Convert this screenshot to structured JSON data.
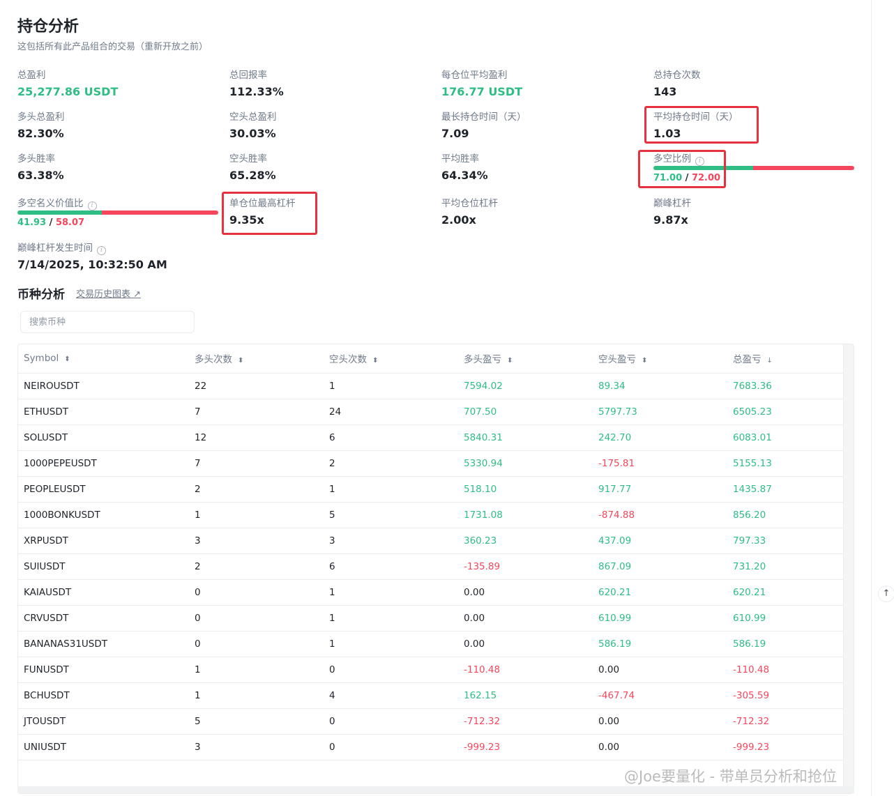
{
  "header": {
    "title": "持仓分析",
    "subtitle": "这包括所有此产品组合的交易（重新开放之前）"
  },
  "stats": {
    "total_pnl": {
      "label": "总盈利",
      "value": "25,277.86 USDT"
    },
    "total_return": {
      "label": "总回报率",
      "value": "112.33%"
    },
    "avg_pnl_per_position": {
      "label": "每仓位平均盈利",
      "value": "176.77 USDT"
    },
    "total_positions": {
      "label": "总持仓次数",
      "value": "143"
    },
    "long_total_pnl": {
      "label": "多头总盈利",
      "value": "82.30%"
    },
    "short_total_pnl": {
      "label": "空头总盈利",
      "value": "30.03%"
    },
    "longest_hold": {
      "label": "最长持仓时间（天）",
      "value": "7.09"
    },
    "avg_hold": {
      "label": "平均持仓时间（天）",
      "value": "1.03"
    },
    "long_win_rate": {
      "label": "多头胜率",
      "value": "63.38%"
    },
    "short_win_rate": {
      "label": "空头胜率",
      "value": "65.28%"
    },
    "avg_win_rate": {
      "label": "平均胜率",
      "value": "64.34%"
    },
    "long_short_ratio": {
      "label": "多空比例",
      "long": "71.00",
      "short": "72.00",
      "separator": "/",
      "long_fraction": 0.4965
    },
    "notional_ratio": {
      "label": "多空名义价值比",
      "long": "41.93",
      "short": "58.07",
      "separator": "/",
      "long_fraction": 0.4193
    },
    "max_leverage": {
      "label": "单仓位最高杠杆",
      "value": "9.35x"
    },
    "avg_leverage": {
      "label": "平均仓位杠杆",
      "value": "2.00x"
    },
    "peak_leverage": {
      "label": "巅峰杠杆",
      "value": "9.87x"
    },
    "peak_leverage_time": {
      "label": "巅峰杠杆发生时间",
      "value": "7/14/2025, 10:32:50 AM"
    }
  },
  "coin_section": {
    "title": "币种分析",
    "history_link": "交易历史图表 ↗",
    "search_placeholder": "搜索币种"
  },
  "table": {
    "headers": [
      "Symbol",
      "多头次数",
      "空头次数",
      "多头盈亏",
      "空头盈亏",
      "总盈亏"
    ],
    "rows": [
      [
        "NEIROUSDT",
        "22",
        "1",
        "7594.02",
        "89.34",
        "7683.36"
      ],
      [
        "ETHUSDT",
        "7",
        "24",
        "707.50",
        "5797.73",
        "6505.23"
      ],
      [
        "SOLUSDT",
        "12",
        "6",
        "5840.31",
        "242.70",
        "6083.01"
      ],
      [
        "1000PEPEUSDT",
        "7",
        "2",
        "5330.94",
        "-175.81",
        "5155.13"
      ],
      [
        "PEOPLEUSDT",
        "2",
        "1",
        "518.10",
        "917.77",
        "1435.87"
      ],
      [
        "1000BONKUSDT",
        "1",
        "5",
        "1731.08",
        "-874.88",
        "856.20"
      ],
      [
        "XRPUSDT",
        "3",
        "3",
        "360.23",
        "437.09",
        "797.33"
      ],
      [
        "SUIUSDT",
        "2",
        "6",
        "-135.89",
        "867.09",
        "731.20"
      ],
      [
        "KAIAUSDT",
        "0",
        "1",
        "0.00",
        "620.21",
        "620.21"
      ],
      [
        "CRVUSDT",
        "0",
        "1",
        "0.00",
        "610.99",
        "610.99"
      ],
      [
        "BANANAS31USDT",
        "0",
        "1",
        "0.00",
        "586.19",
        "586.19"
      ],
      [
        "FUNUSDT",
        "1",
        "0",
        "-110.48",
        "0.00",
        "-110.48"
      ],
      [
        "BCHUSDT",
        "1",
        "4",
        "162.15",
        "-467.74",
        "-305.59"
      ],
      [
        "JTOUSDT",
        "5",
        "0",
        "-712.32",
        "0.00",
        "-712.32"
      ],
      [
        "UNIUSDT",
        "3",
        "0",
        "-999.23",
        "0.00",
        "-999.23"
      ]
    ]
  },
  "watermark": "@Joe要量化 - 带单员分析和抢位",
  "colors": {
    "green": "#2ebd85",
    "red": "#f6465d",
    "highlight": "#e5323e"
  }
}
